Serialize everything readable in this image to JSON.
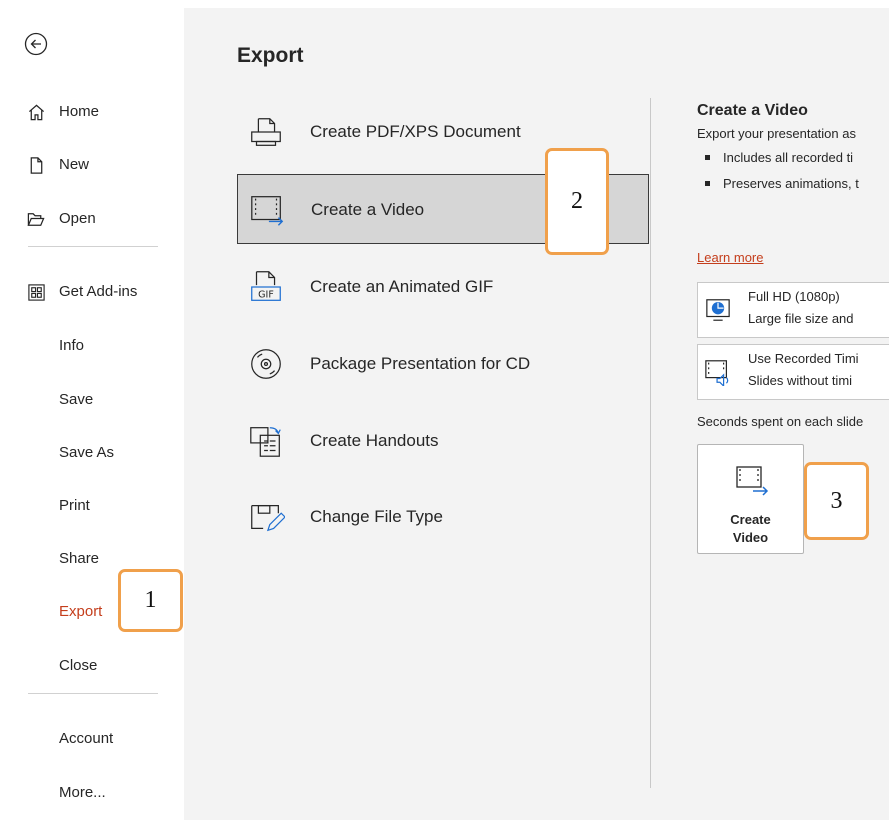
{
  "sidebar": {
    "back_icon": "back-arrow-circle-icon",
    "items": [
      {
        "label": "Home",
        "icon": "home-icon"
      },
      {
        "label": "New",
        "icon": "new-document-icon"
      },
      {
        "label": "Open",
        "icon": "folder-open-icon"
      },
      {
        "label": "Get Add-ins",
        "icon": "add-ins-grid-icon"
      },
      {
        "label": "Info"
      },
      {
        "label": "Save"
      },
      {
        "label": "Save As"
      },
      {
        "label": "Print"
      },
      {
        "label": "Share"
      },
      {
        "label": "Export",
        "active": true
      },
      {
        "label": "Close"
      },
      {
        "label": "Account"
      },
      {
        "label": "More..."
      }
    ]
  },
  "main": {
    "title": "Export",
    "items": [
      {
        "label": "Create PDF/XPS Document",
        "icon": "pdf-document-icon"
      },
      {
        "label": "Create a Video",
        "icon": "video-film-icon",
        "selected": true
      },
      {
        "label": "Create an Animated GIF",
        "icon": "gif-icon"
      },
      {
        "label": "Package Presentation for CD",
        "icon": "cd-disc-icon"
      },
      {
        "label": "Create Handouts",
        "icon": "handouts-icon"
      },
      {
        "label": "Change File Type",
        "icon": "change-file-type-icon"
      }
    ]
  },
  "detail": {
    "title": "Create a Video",
    "description": "Export your presentation as",
    "bullets": [
      "Includes all recorded ti",
      "Preserves animations, t"
    ],
    "learn_more": "Learn more",
    "quality_option": {
      "line1": "Full HD (1080p)",
      "line2": "Large file size and",
      "icon": "hd-monitor-icon"
    },
    "timing_option": {
      "line1": "Use Recorded Timi",
      "line2": "Slides without timi",
      "icon": "recorded-timing-icon"
    },
    "seconds_label": "Seconds spent on each slide",
    "create_button": {
      "line1": "Create",
      "line2": "Video",
      "icon": "video-film-icon"
    }
  },
  "callouts": [
    "1",
    "2",
    "3"
  ],
  "colors": {
    "accent": "#c43e1c",
    "callout_border": "#f0a04b",
    "selected_bg": "#d6d6d6"
  }
}
